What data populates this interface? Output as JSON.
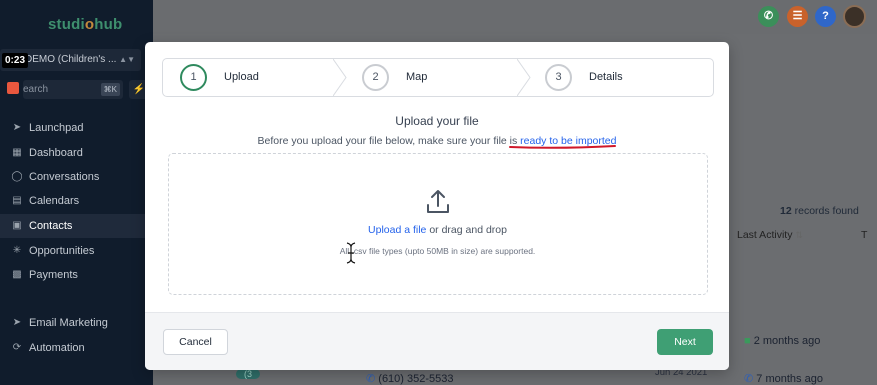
{
  "app": {
    "logo_text_a": "studi",
    "logo_text_dot": "o",
    "logo_text_b": "hub",
    "timer": "0:23",
    "account_label": "DEMO (Children's ...",
    "search_placeholder": "earch",
    "search_shortcut": "⌘K"
  },
  "sidebar": {
    "items": [
      {
        "label": "Launchpad",
        "icon": "rocket-icon"
      },
      {
        "label": "Dashboard",
        "icon": "grid-icon"
      },
      {
        "label": "Conversations",
        "icon": "chat-icon"
      },
      {
        "label": "Calendars",
        "icon": "calendar-icon"
      },
      {
        "label": "Contacts",
        "icon": "contacts-icon"
      },
      {
        "label": "Opportunities",
        "icon": "funnel-icon"
      },
      {
        "label": "Payments",
        "icon": "receipt-icon"
      },
      {
        "label": "Email Marketing",
        "icon": "send-icon"
      },
      {
        "label": "Automation",
        "icon": "automation-icon"
      }
    ]
  },
  "background": {
    "records_count": "12",
    "records_label": "records found",
    "col_last_activity": "Last Activity",
    "col_next": "T",
    "row1_activity": "2 months ago",
    "row2_phone": "(610) 352-5533",
    "row2_date": "Jun 24 2021",
    "row2_activity": "7 months ago",
    "row2_badge": "(3"
  },
  "wizard": {
    "steps": [
      {
        "num": "1",
        "label": "Upload"
      },
      {
        "num": "2",
        "label": "Map"
      },
      {
        "num": "3",
        "label": "Details"
      }
    ],
    "title": "Upload your file",
    "subtitle_prefix": "Before you upload your file below, make sure your file is",
    "subtitle_link": "ready to be imported",
    "upload_link": "Upload a file",
    "upload_rest": "or drag and drop",
    "support_text": "All .csv file types (upto 50MB in size) are supported.",
    "cancel_label": "Cancel",
    "next_label": "Next"
  },
  "colors": {
    "accent_green": "#3f9f74",
    "link_blue": "#2563eb",
    "annotation_red": "#d0182a"
  }
}
